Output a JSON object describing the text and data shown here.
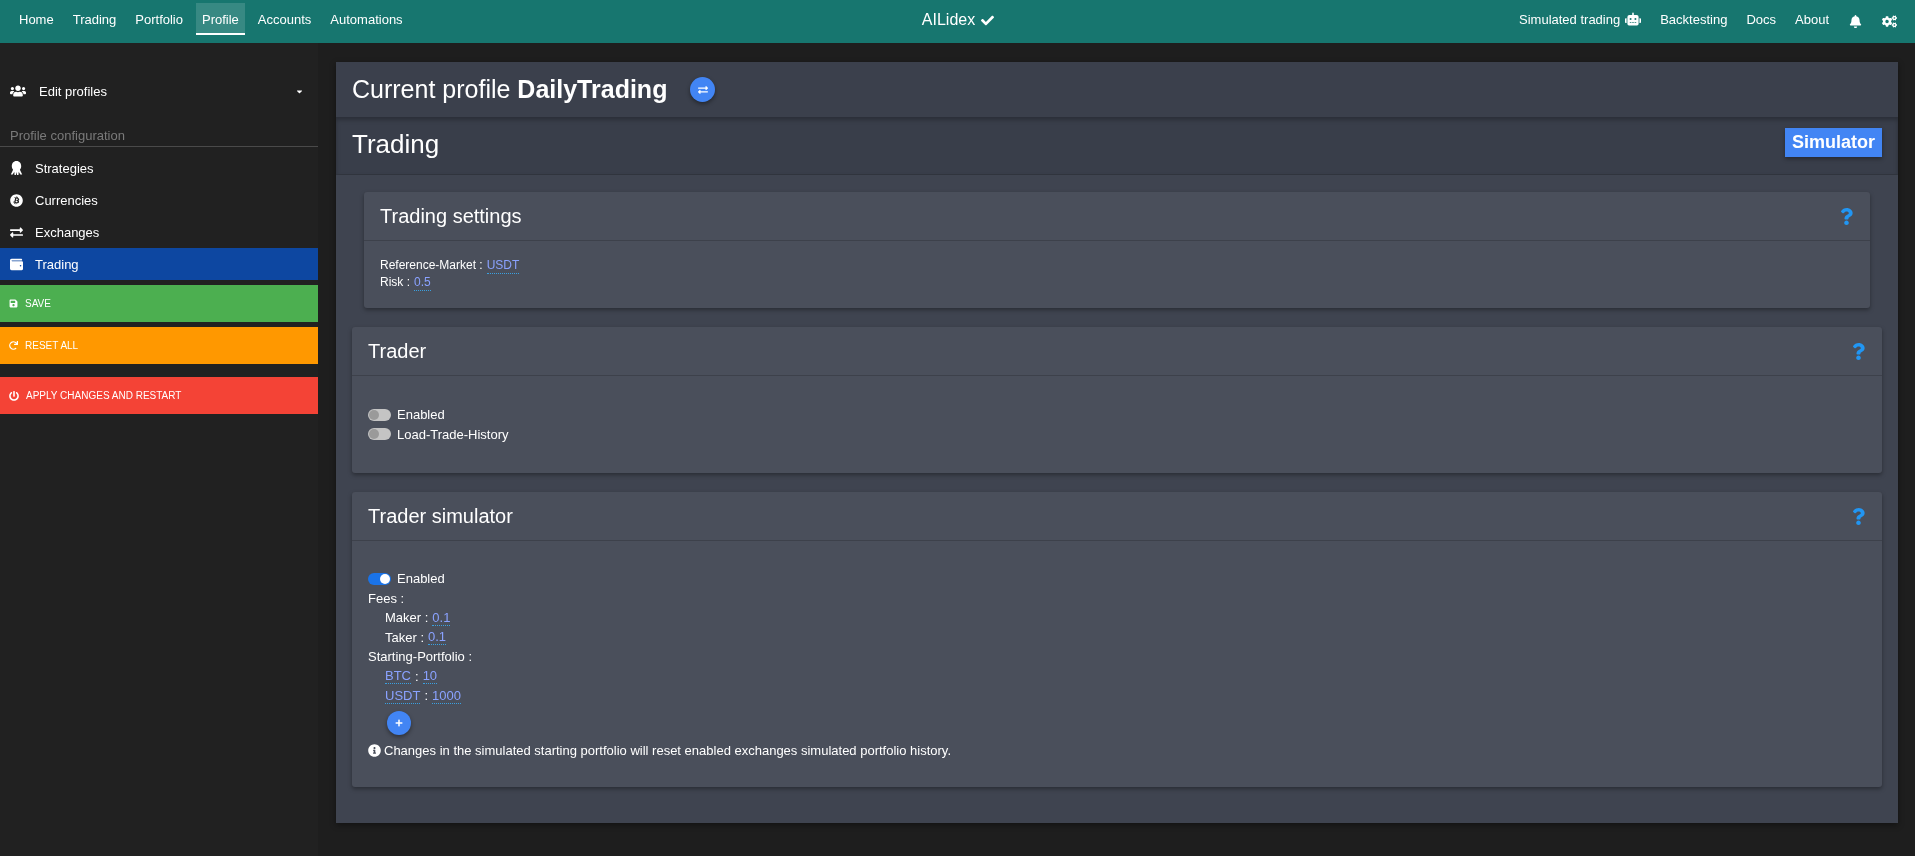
{
  "top_nav": {
    "items": [
      {
        "label": "Home",
        "selected": false
      },
      {
        "label": "Trading",
        "selected": false
      },
      {
        "label": "Portfolio",
        "selected": false
      },
      {
        "label": "Profile",
        "selected": true
      },
      {
        "label": "Accounts",
        "selected": false
      },
      {
        "label": "Automations",
        "selected": false
      }
    ],
    "brand": "AILidex",
    "right_items": [
      {
        "label": "Simulated trading"
      },
      {
        "label": "Backtesting"
      },
      {
        "label": "Docs"
      },
      {
        "label": "About"
      }
    ]
  },
  "sidebar": {
    "profiles_menu": "Edit profiles",
    "section_title": "Profile configuration",
    "items": [
      {
        "label": "Strategies",
        "selected": false
      },
      {
        "label": "Currencies",
        "selected": false
      },
      {
        "label": "Exchanges",
        "selected": false
      },
      {
        "label": "Trading",
        "selected": true
      }
    ],
    "actions": [
      {
        "label": "SAVE",
        "color": "#4caf50"
      },
      {
        "label": "RESET ALL",
        "color": "#ff9800"
      },
      {
        "label": "APPLY CHANGES AND RESTART",
        "color": "#f44336"
      }
    ]
  },
  "current_profile": {
    "title": "Current profile **DailyTrading**"
  },
  "section": {
    "title": "Trading",
    "badge": "Simulator"
  },
  "trading_settings": {
    "title": "Trading settings",
    "fields": [
      {
        "label": "Reference-Market :",
        "value": "USDT"
      },
      {
        "label": "Risk :",
        "value": "0.5"
      }
    ]
  },
  "trader": {
    "title": "Trader",
    "toggles": [
      {
        "label": "Enabled",
        "on": false
      },
      {
        "label": "Load-Trade-History",
        "on": false
      }
    ]
  },
  "trader_simulator": {
    "title": "Trader simulator",
    "toggles": [
      {
        "label": "Enabled",
        "on": true
      }
    ],
    "fees": {
      "label": "Fees :",
      "fields": [
        {
          "label": "Maker :",
          "value": "0.1"
        },
        {
          "label": "Taker :",
          "value": "0.1"
        }
      ]
    },
    "starting_portfolio": {
      "label": "Starting-Portfolio :",
      "entries": [
        {
          "asset": "BTC",
          "separator": ":",
          "amount": "10"
        },
        {
          "asset": "USDT",
          "separator": ":",
          "amount": "1000"
        }
      ]
    },
    "note": "Changes in the simulated starting portfolio will reset enabled exchanges simulated portfolio history."
  }
}
